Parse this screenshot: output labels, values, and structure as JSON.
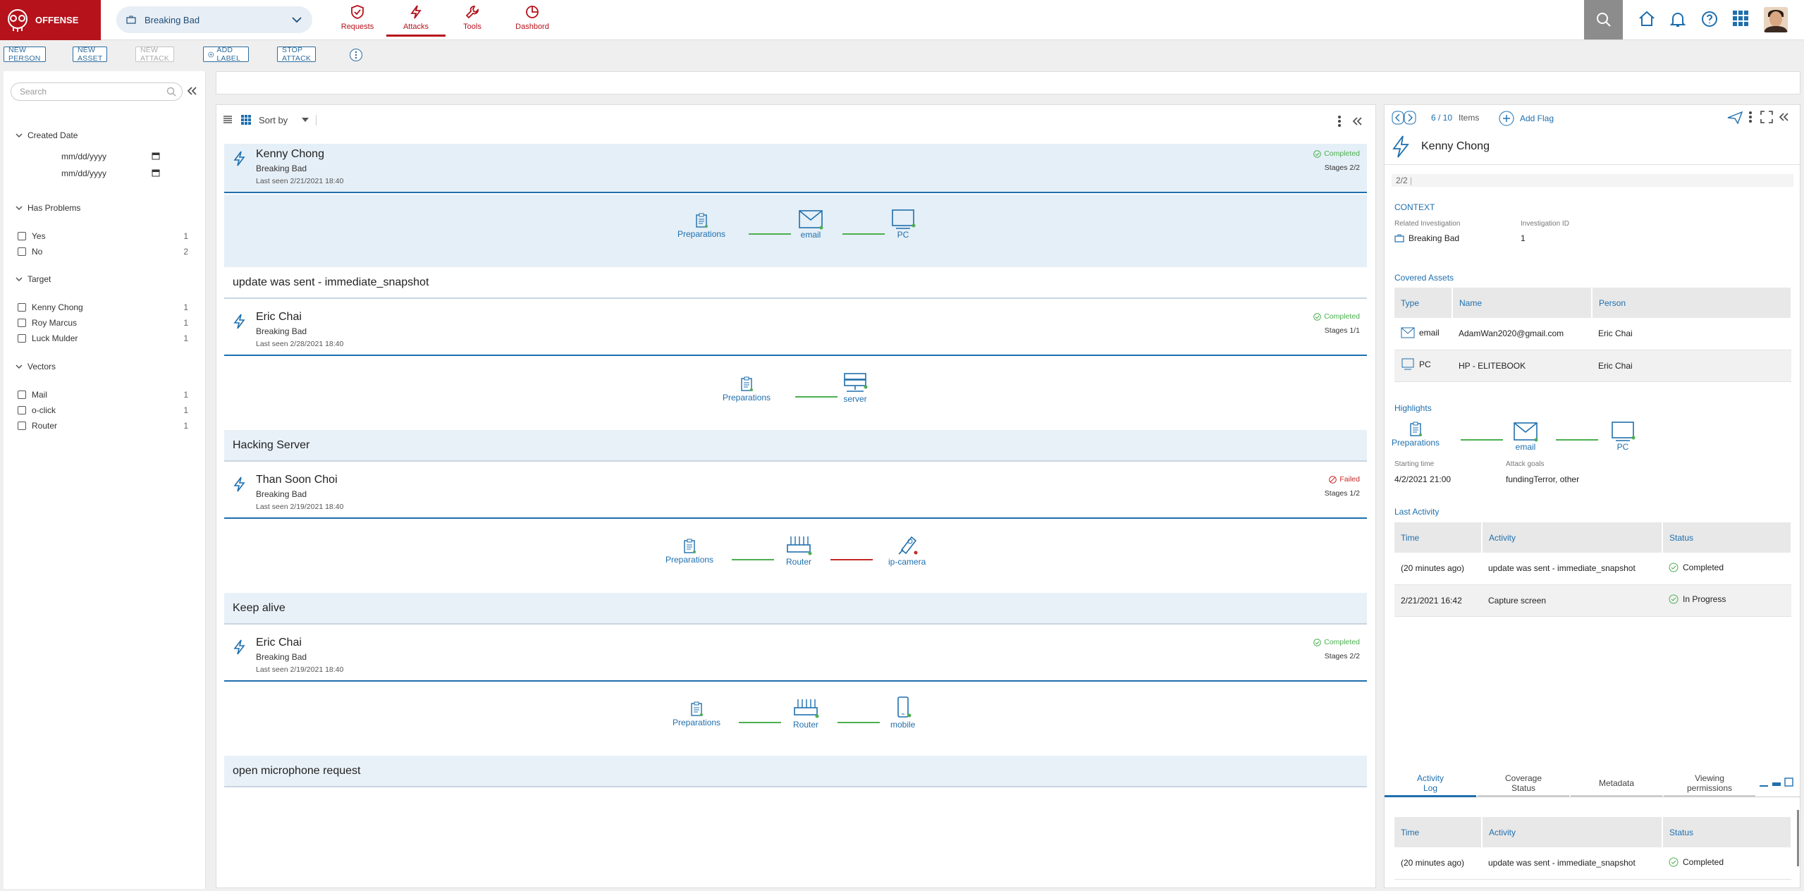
{
  "app": {
    "name": "OFFENSE"
  },
  "investigation": {
    "name": "Breaking Bad"
  },
  "nav": [
    {
      "label": "Requests"
    },
    {
      "label": "Attacks"
    },
    {
      "label": "Tools"
    },
    {
      "label": "Dashbord"
    }
  ],
  "toolbar": {
    "new_person": "NEW PERSON",
    "new_asset": "NEW ASSET",
    "new_attack": "NEW ATTACK",
    "add_label": "ADD LABEL",
    "stop_attack": "STOP ATTACK"
  },
  "filters": {
    "search_placeholder": "Search",
    "created_date": {
      "title": "Created Date",
      "from": "mm/dd/yyyy",
      "to": "mm/dd/yyyy"
    },
    "has_problems": {
      "title": "Has Problems",
      "options": [
        {
          "label": "Yes",
          "count": "1"
        },
        {
          "label": "No",
          "count": "2"
        }
      ]
    },
    "target": {
      "title": "Target",
      "options": [
        {
          "label": "Kenny Chong",
          "count": "1"
        },
        {
          "label": "Roy Marcus",
          "count": "1"
        },
        {
          "label": "Luck Mulder",
          "count": "1"
        }
      ]
    },
    "vectors": {
      "title": "Vectors",
      "options": [
        {
          "label": "Mail",
          "count": "1"
        },
        {
          "label": "o-click",
          "count": "1"
        },
        {
          "label": "Router",
          "count": "1"
        }
      ]
    }
  },
  "list": {
    "sort_label": "Sort by",
    "attacks": [
      {
        "person": "Kenny Chong",
        "investigation": "Breaking Bad",
        "last_seen": "Last seen 2/21/2021 18:40",
        "status": "Completed",
        "stages": "Stages 2/2",
        "nodes": [
          "Preparations",
          "email",
          "PC"
        ],
        "message": "update was sent - immediate_snapshot"
      },
      {
        "person": "Eric Chai",
        "investigation": "Breaking Bad",
        "last_seen": "Last seen 2/28/2021 18:40",
        "status": "Completed",
        "stages": "Stages 1/1",
        "nodes": [
          "Preparations",
          "server"
        ],
        "message": "Hacking Server"
      },
      {
        "person": "Than Soon Choi",
        "investigation": "Breaking Bad",
        "last_seen": "Last seen 2/19/2021 18:40",
        "status": "Failed",
        "stages": "Stages 1/2",
        "nodes": [
          "Preparations",
          "Router",
          "ip-camera"
        ],
        "message": "Keep alive"
      },
      {
        "person": "Eric Chai",
        "investigation": "Breaking Bad",
        "last_seen": "Last seen 2/19/2021 18:40",
        "status": "Completed",
        "stages": "Stages 2/2",
        "nodes": [
          "Preparations",
          "Router",
          "mobile"
        ],
        "message": "open microphone request"
      }
    ]
  },
  "detail": {
    "pager": "6 / 10",
    "items_label": "Items",
    "add_flag": "Add Flag",
    "title": "Kenny Chong",
    "stage_count": "2/2",
    "context": {
      "title": "CONTEXT",
      "related_label": "Related Investigation",
      "related_value": "Breaking Bad",
      "id_label": "Investigation ID",
      "id_value": "1"
    },
    "covered_assets": {
      "title": "Covered Assets",
      "headers": [
        "Type",
        "Name",
        "Person"
      ],
      "rows": [
        {
          "type": "email",
          "name": "AdamWan2020@gmail.com",
          "person": "Eric Chai"
        },
        {
          "type": "PC",
          "name": "HP - ELITEBOOK",
          "person": "Eric Chai"
        }
      ]
    },
    "highlights": {
      "title": "Highlights",
      "nodes": [
        "Preparations",
        "email",
        "PC"
      ],
      "start_label": "Starting time",
      "start_value": "4/2/2021 21:00",
      "goals_label": "Attack goals",
      "goals_value": "fundingTerror, other"
    },
    "last_activity": {
      "title": "Last Activity",
      "headers": [
        "Time",
        "Activity",
        "Status"
      ],
      "rows": [
        {
          "time": "(20 minutes ago)",
          "activity": "update was sent - immediate_snapshot",
          "status": "Completed"
        },
        {
          "time": "2/21/2021 16:42",
          "activity": "Capture screen",
          "status": "In Progress"
        }
      ]
    },
    "tabs": [
      {
        "label": "Activity\nLog"
      },
      {
        "label": "Coverage\nStatus"
      },
      {
        "label": "Metadata"
      },
      {
        "label": "Viewing\npermissions"
      }
    ],
    "log": {
      "headers": [
        "Time",
        "Activity",
        "Status"
      ],
      "rows": [
        {
          "time": "(20 minutes ago)",
          "activity": "update was sent - immediate_snapshot",
          "status": "Completed"
        }
      ]
    }
  },
  "colors": {
    "brand": "#b5121b",
    "accent": "#1f6fad",
    "success": "#4caf50",
    "fail": "#c62828"
  }
}
